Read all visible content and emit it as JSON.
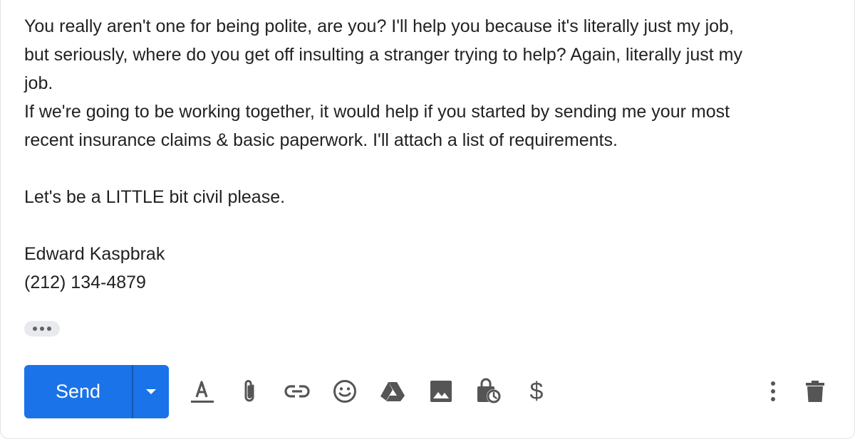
{
  "message": {
    "lines": [
      "You really aren't one for being polite, are you? I'll help you because it's literally just my job,",
      "but seriously, where do you get off insulting a stranger trying to help? Again, literally just my",
      "job.",
      "If we're going to be working together, it would help if you started by sending me your most",
      "recent insurance claims & basic paperwork. I'll attach a list of requirements.",
      "",
      "Let's be a LITTLE bit civil please.",
      "",
      "Edward Kaspbrak",
      "(212) 134-4879"
    ]
  },
  "trimmed_content": {
    "icon": "more-horiz-icon"
  },
  "toolbar": {
    "send_label": "Send",
    "send_color": "#1a73e8",
    "icons": [
      "text-formatting-icon",
      "attach-file-icon",
      "insert-link-icon",
      "emoji-icon",
      "google-drive-icon",
      "insert-photo-icon",
      "confidential-mode-icon",
      "dollar-icon",
      "more-options-icon",
      "discard-draft-icon"
    ],
    "dollar_glyph": "$"
  },
  "colors": {
    "text": "#222222",
    "icon": "#555555",
    "accent": "#1a73e8"
  }
}
